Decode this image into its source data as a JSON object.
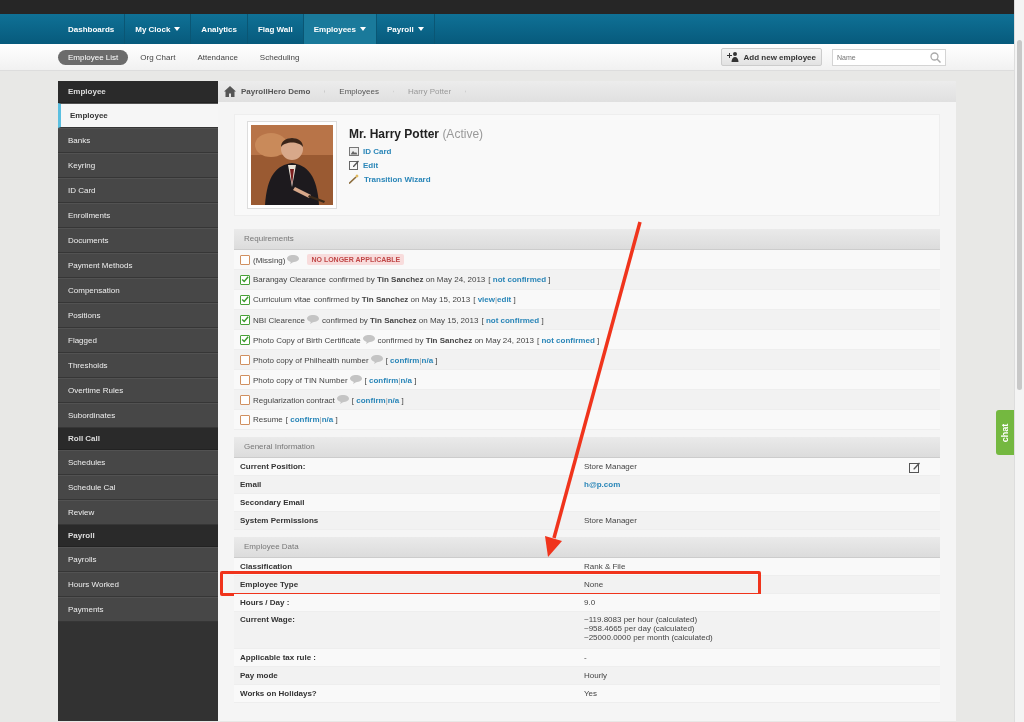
{
  "top_nav": {
    "items": [
      {
        "label": "Dashboards",
        "dropdown": false,
        "selected": false
      },
      {
        "label": "My Clock",
        "dropdown": true,
        "selected": false
      },
      {
        "label": "Analytics",
        "dropdown": false,
        "selected": false
      },
      {
        "label": "Flag Wall",
        "dropdown": false,
        "selected": false
      },
      {
        "label": "Employees",
        "dropdown": true,
        "selected": true
      },
      {
        "label": "Payroll",
        "dropdown": true,
        "selected": false
      }
    ]
  },
  "sub_nav": {
    "items": [
      {
        "label": "Employee List",
        "selected": true
      },
      {
        "label": "Org Chart",
        "selected": false
      },
      {
        "label": "Attendance",
        "selected": false
      },
      {
        "label": "Scheduling",
        "selected": false
      }
    ],
    "add_button": "Add new employee",
    "search": {
      "placeholder": "Name"
    }
  },
  "sidebar": {
    "items": [
      {
        "kind": "header",
        "label": "Employee"
      },
      {
        "kind": "item",
        "label": "Employee",
        "selected": true
      },
      {
        "kind": "item",
        "label": "Banks",
        "selected": false
      },
      {
        "kind": "item",
        "label": "Keyring",
        "selected": false
      },
      {
        "kind": "item",
        "label": "ID Card",
        "selected": false
      },
      {
        "kind": "item",
        "label": "Enrollments",
        "selected": false
      },
      {
        "kind": "item",
        "label": "Documents",
        "selected": false
      },
      {
        "kind": "item",
        "label": "Payment Methods",
        "selected": false
      },
      {
        "kind": "item",
        "label": "Compensation",
        "selected": false
      },
      {
        "kind": "item",
        "label": "Positions",
        "selected": false
      },
      {
        "kind": "item",
        "label": "Flagged",
        "selected": false
      },
      {
        "kind": "item",
        "label": "Thresholds",
        "selected": false
      },
      {
        "kind": "item",
        "label": "Overtime Rules",
        "selected": false
      },
      {
        "kind": "item",
        "label": "Subordinates",
        "selected": false
      },
      {
        "kind": "header",
        "label": "Roll Call"
      },
      {
        "kind": "item",
        "label": "Schedules",
        "selected": false
      },
      {
        "kind": "item",
        "label": "Schedule Cal",
        "selected": false
      },
      {
        "kind": "item",
        "label": "Review",
        "selected": false
      },
      {
        "kind": "header",
        "label": "Payroll"
      },
      {
        "kind": "item",
        "label": "Payrolls",
        "selected": false
      },
      {
        "kind": "item",
        "label": "Hours Worked",
        "selected": false
      },
      {
        "kind": "item",
        "label": "Payments",
        "selected": false
      }
    ]
  },
  "breadcrumb": [
    {
      "label": "PayrollHero Demo",
      "current": false
    },
    {
      "label": "Employees",
      "current": false
    },
    {
      "label": "Harry Potter",
      "current": true
    }
  ],
  "profile": {
    "name": "Mr. Harry Potter",
    "status": "(Active)",
    "actions": [
      {
        "label": "ID Card"
      },
      {
        "label": "Edit"
      },
      {
        "label": "Transition Wizard"
      }
    ]
  },
  "requirements": {
    "title": "Requirements",
    "bracket_open": "[",
    "bracket_close": "]",
    "separator": "|",
    "items": [
      {
        "checked": false,
        "name": "(Missing)",
        "comment": true,
        "badge": "NO LONGER APPLICABLE"
      },
      {
        "checked": true,
        "name": "Barangay Clearance",
        "comment": false,
        "detail": "confirmed by **Tin Sanchez** on May 24, 2013",
        "links": [
          "not confirmed"
        ]
      },
      {
        "checked": true,
        "name": "Curriculum vitae",
        "comment": false,
        "detail": "confirmed by **Tin Sanchez** on May 15, 2013",
        "links": [
          "view",
          "edit"
        ]
      },
      {
        "checked": true,
        "name": "NBI Clearence",
        "comment": true,
        "detail": "confirmed by **Tin Sanchez** on May 15, 2013",
        "links": [
          "not confirmed"
        ]
      },
      {
        "checked": true,
        "name": "Photo Copy of Birth Certificate",
        "comment": true,
        "detail": "confirmed by **Tin Sanchez** on May 24, 2013",
        "links": [
          "not confirmed"
        ]
      },
      {
        "checked": false,
        "name": "Photo copy of Philhealth number",
        "comment": true,
        "links": [
          "confirm",
          "n/a"
        ]
      },
      {
        "checked": false,
        "name": "Photo copy of TIN Number",
        "comment": true,
        "links": [
          "confirm",
          "n/a"
        ]
      },
      {
        "checked": false,
        "name": "Regularization contract",
        "comment": true,
        "links": [
          "confirm",
          "n/a"
        ]
      },
      {
        "checked": false,
        "name": "Resume",
        "comment": false,
        "links": [
          "confirm",
          "n/a"
        ]
      }
    ]
  },
  "general_information": {
    "title": "General Information",
    "rows": [
      {
        "label": "Current Position:",
        "value": "Store Manager",
        "link": false,
        "editable": true
      },
      {
        "label": "Email",
        "value": "h@p.com",
        "link": true,
        "editable": false
      },
      {
        "label": "Secondary Email",
        "editable": false
      },
      {
        "label": "System Permissions",
        "value": "Store Manager",
        "link": false,
        "editable": false
      }
    ]
  },
  "employee_data": {
    "title": "Employee Data",
    "rows": [
      {
        "label": "Classification",
        "lines": [
          "Rank & File"
        ],
        "highlighted": false
      },
      {
        "label": "Employee Type",
        "lines": [
          "None"
        ],
        "highlighted": true
      },
      {
        "label": "Hours / Day :",
        "lines": [
          "9.0"
        ],
        "highlighted": false
      },
      {
        "label": "Current Wage:",
        "lines": [
          "~119.8083 per hour (calculated)",
          "~958.4665 per day (calculated)",
          "~25000.0000 per month (calculated)"
        ],
        "highlighted": false
      },
      {
        "label": "Applicable tax rule :",
        "lines": [
          "-"
        ],
        "highlighted": false
      },
      {
        "label": "Pay mode",
        "lines": [
          "Hourly"
        ],
        "highlighted": false
      },
      {
        "label": "Works on Holidays?",
        "lines": [
          "Yes"
        ],
        "highlighted": false
      }
    ]
  },
  "chat_tab": "chat"
}
